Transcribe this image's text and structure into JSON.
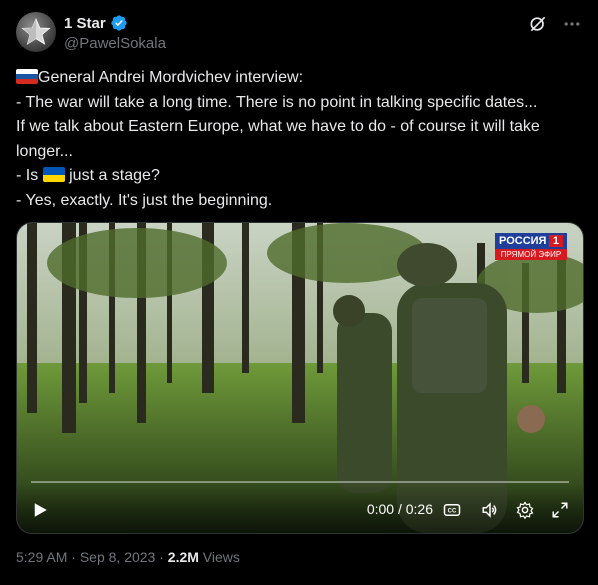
{
  "author": {
    "display_name": "1 Star",
    "handle": "@PawelSokala",
    "verified": true,
    "avatar_icon": "star-avatar-icon"
  },
  "actions": {
    "grok_icon": "grok-icon",
    "more_icon": "more-icon"
  },
  "tweet": {
    "line1": "General Andrei Mordvichev interview:",
    "line2": "- The war will take a long time. There is no point in talking specific dates...",
    "line3": "If we talk about Eastern Europe, what we have to do - of course it will take",
    "line4": "longer...",
    "line5_pre": "- Is ",
    "line5_post": " just a stage?",
    "line6": "- Yes, exactly. It's just the beginning.",
    "flags": [
      "russia-flag-icon",
      "ukraine-flag-icon"
    ]
  },
  "video": {
    "channel_name": "РОССИЯ",
    "channel_number": "1",
    "channel_sub": "ПРЯМОЙ ЭФИР",
    "current_time": "0:00 / 0:26",
    "progress": 0,
    "icons": [
      "play-icon",
      "captions-icon",
      "volume-icon",
      "settings-icon",
      "fullscreen-icon"
    ]
  },
  "meta": {
    "time": "5:29 AM",
    "separator": " · ",
    "date": "Sep 8, 2023",
    "separator2": " · ",
    "views_count": "2.2M",
    "views_label": " Views"
  },
  "colors": {
    "background": "#000000",
    "text": "#e7e9ea",
    "secondary": "#71767b",
    "verified": "#1d9bf0"
  }
}
